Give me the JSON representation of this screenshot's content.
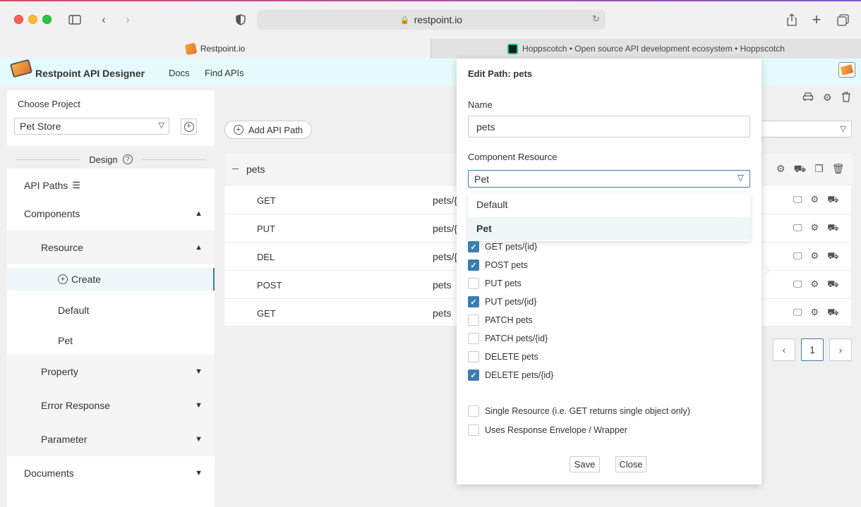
{
  "browser": {
    "url": "restpoint.io",
    "tabs": [
      {
        "title": "Restpoint.io"
      },
      {
        "title": "Hoppscotch • Open source API development ecosystem • Hoppscotch"
      }
    ]
  },
  "header": {
    "title": "Restpoint API Designer",
    "nav": [
      "Docs",
      "Find APIs"
    ]
  },
  "sidebar": {
    "choose_project_label": "Choose Project",
    "project_value": "Pet Store",
    "design_label": "Design",
    "items": {
      "api_paths": "API Paths",
      "components": "Components",
      "resource": "Resource",
      "create": "Create",
      "default": "Default",
      "pet": "Pet",
      "property": "Property",
      "error_response": "Error Response",
      "parameter": "Parameter",
      "documents": "Documents"
    }
  },
  "main": {
    "add_path_label": "Add API Path",
    "path_group": "pets",
    "rows": [
      {
        "method": "GET",
        "path": "pets/{"
      },
      {
        "method": "PUT",
        "path": "pets/{"
      },
      {
        "method": "DEL",
        "path": "pets/{"
      },
      {
        "method": "POST",
        "path": "pets"
      },
      {
        "method": "GET",
        "path": "pets"
      }
    ],
    "pager_current": "1"
  },
  "modal": {
    "title": "Edit Path: pets",
    "name_label": "Name",
    "name_value": "pets",
    "component_label": "Component Resource",
    "component_value": "Pet",
    "options": [
      "Default",
      "Pet"
    ],
    "checkboxes": [
      {
        "label": "GET pets/{id}",
        "checked": true
      },
      {
        "label": "POST pets",
        "checked": true
      },
      {
        "label": "PUT pets",
        "checked": false
      },
      {
        "label": "PUT pets/{id}",
        "checked": true
      },
      {
        "label": "PATCH pets",
        "checked": false
      },
      {
        "label": "PATCH pets/{id}",
        "checked": false
      },
      {
        "label": "DELETE pets",
        "checked": false
      },
      {
        "label": "DELETE pets/{id}",
        "checked": true
      }
    ],
    "single_resource_label": "Single Resource (i.e. GET returns single object only)",
    "envelope_label": "Uses Response Envelope / Wrapper",
    "save_label": "Save",
    "close_label": "Close"
  },
  "colors": {
    "accent": "#3b7db0",
    "header_bg": "#e5fbfb"
  }
}
